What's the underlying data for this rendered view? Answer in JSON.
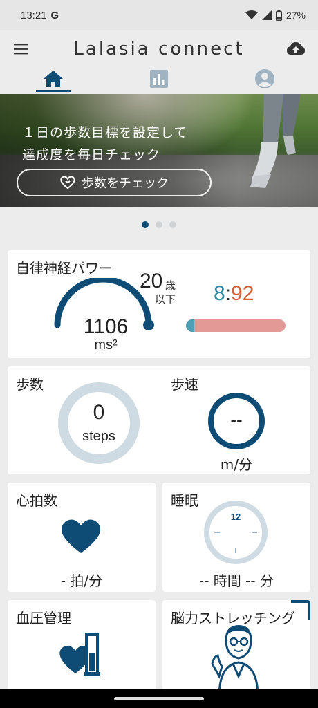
{
  "status_bar": {
    "time": "13:21",
    "g": "G",
    "battery": "27%"
  },
  "app_bar": {
    "title": "Lalasia connect"
  },
  "tabs": [
    {
      "name": "home",
      "icon": "home-icon",
      "active": true
    },
    {
      "name": "chart",
      "icon": "bar-chart-icon",
      "active": false
    },
    {
      "name": "account",
      "icon": "account-icon",
      "active": false
    }
  ],
  "banner": {
    "line1": "１日の歩数目標を設定して",
    "line2": "達成度を毎日チェック",
    "button_label": "歩数をチェック",
    "button_icon": "heart-hands-icon"
  },
  "carousel": {
    "pages": 3,
    "active": 0
  },
  "ans": {
    "title": "自律神経パワー",
    "value": "1106",
    "unit": "ms²",
    "gauge_level": 0.5,
    "age_value": "20",
    "age_unit": "歳",
    "age_sub": "以下",
    "ratio_a": "8",
    "ratio_sep": ":",
    "ratio_b": "92",
    "ratio_fraction": 0.08
  },
  "steps": {
    "title": "歩数",
    "value": "0",
    "unit": "steps"
  },
  "speed": {
    "title": "歩速",
    "value": "--",
    "unit": "m/分"
  },
  "heart_rate": {
    "title": "心拍数",
    "value": "- 拍/分"
  },
  "sleep": {
    "title": "睡眠",
    "value": "-- 時間 -- 分",
    "clock_label": "12"
  },
  "blood_pressure": {
    "title": "血圧管理"
  },
  "brain": {
    "title": "脳力ストレッチング"
  },
  "colors": {
    "primary": "#0f4c75",
    "ring_gray": "#cfdbe3",
    "ratio_a": "#2c8aa6",
    "ratio_b": "#d4603a",
    "bar_b": "#e39a96"
  }
}
